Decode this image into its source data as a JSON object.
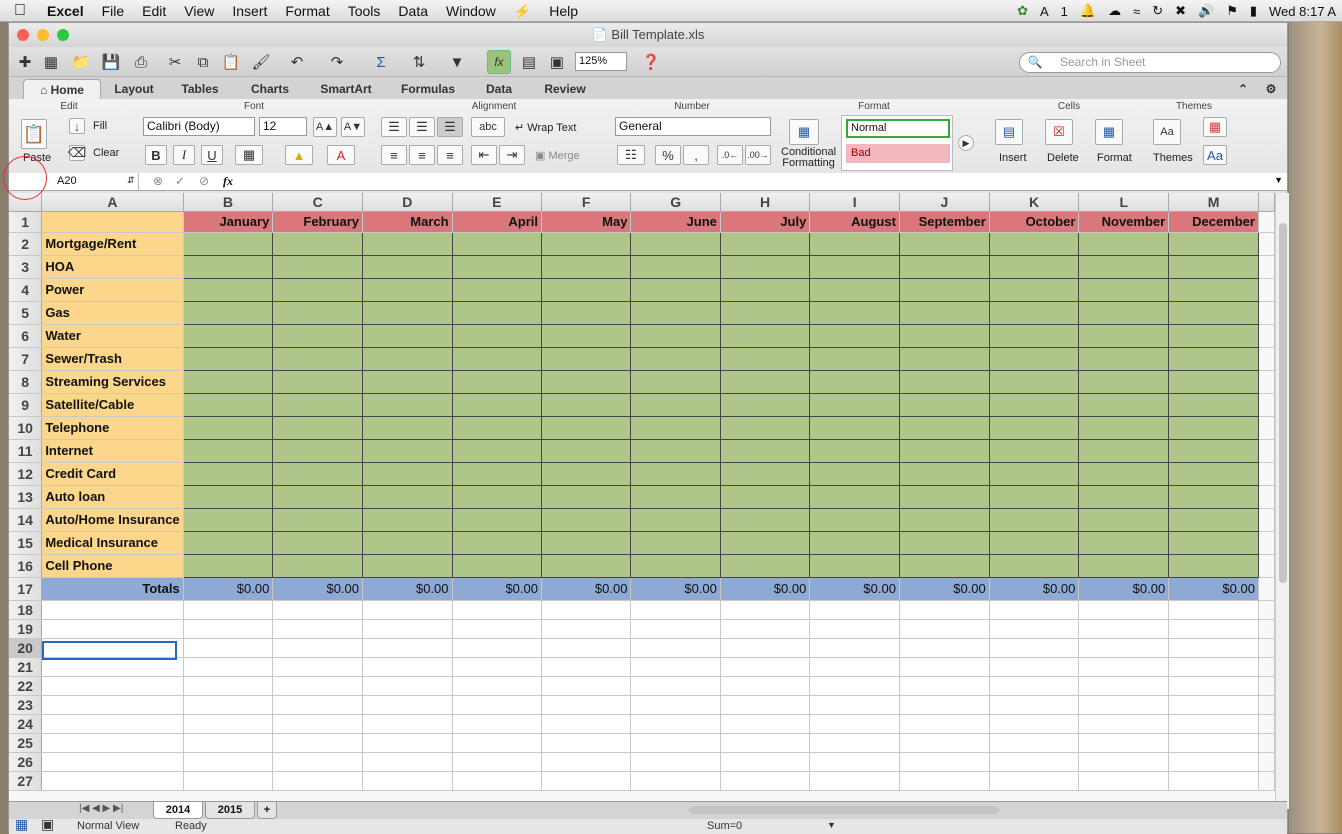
{
  "menubar": {
    "apple": "",
    "app": "Excel",
    "items": [
      "File",
      "Edit",
      "View",
      "Insert",
      "Format",
      "Tools",
      "Data",
      "Window",
      "Help"
    ],
    "right": {
      "notifications": "1",
      "clock": "Wed 8:17 A"
    }
  },
  "window": {
    "title": "Bill Template.xls"
  },
  "toolbar": {
    "zoom": "125%",
    "search_placeholder": "Search in Sheet"
  },
  "ribbon_tabs": [
    "Home",
    "Layout",
    "Tables",
    "Charts",
    "SmartArt",
    "Formulas",
    "Data",
    "Review"
  ],
  "ribbon": {
    "groups": {
      "edit": "Edit",
      "font": "Font",
      "alignment": "Alignment",
      "number": "Number",
      "format": "Format",
      "cells": "Cells",
      "themes": "Themes"
    },
    "paste": "Paste",
    "fill": "Fill",
    "clear": "Clear",
    "font_name": "Calibri (Body)",
    "font_size": "12",
    "wrap_text": "Wrap Text",
    "merge": "Merge",
    "number_format": "General",
    "pct": "%",
    "comma": ",",
    "conditional": "Conditional",
    "formatting": "Formatting",
    "style_normal": "Normal",
    "style_bad": "Bad",
    "insert": "Insert",
    "delete": "Delete",
    "format_btn": "Format",
    "themes_btn": "Themes",
    "fonts_btn": "Aa"
  },
  "formula_bar": {
    "name_box": "A20",
    "fx": "fx",
    "value": ""
  },
  "columns": [
    "A",
    "B",
    "C",
    "D",
    "E",
    "F",
    "G",
    "H",
    "I",
    "J",
    "K",
    "L",
    "M"
  ],
  "months": [
    "January",
    "February",
    "March",
    "April",
    "May",
    "June",
    "July",
    "August",
    "September",
    "October",
    "November",
    "December"
  ],
  "rows": [
    "",
    "Mortgage/Rent",
    "HOA",
    "Power",
    "Gas",
    "Water",
    "Sewer/Trash",
    "Streaming Services",
    "Satellite/Cable",
    "Telephone",
    "Internet",
    "Credit Card",
    "Auto loan",
    "Auto/Home Insurance",
    "Medical Insurance",
    "Cell Phone"
  ],
  "totals_label": "Totals",
  "totals": [
    "$0.00",
    "$0.00",
    "$0.00",
    "$0.00",
    "$0.00",
    "$0.00",
    "$0.00",
    "$0.00",
    "$0.00",
    "$0.00",
    "$0.00",
    "$0.00"
  ],
  "row_numbers": [
    "1",
    "2",
    "3",
    "4",
    "5",
    "6",
    "7",
    "8",
    "9",
    "10",
    "11",
    "12",
    "13",
    "14",
    "15",
    "16",
    "17",
    "18",
    "19",
    "20",
    "21",
    "22",
    "23",
    "24",
    "25",
    "26",
    "27"
  ],
  "sheets": [
    "2014",
    "2015",
    "+"
  ],
  "status": {
    "view": "Normal View",
    "ready": "Ready",
    "sum": "Sum=0"
  },
  "colors": {
    "label_bg": "#fbd68b",
    "month_bg": "#d9777a",
    "data_bg": "#b0c58a",
    "totals_bg": "#8ea9d4",
    "selection": "#2a66c6"
  }
}
